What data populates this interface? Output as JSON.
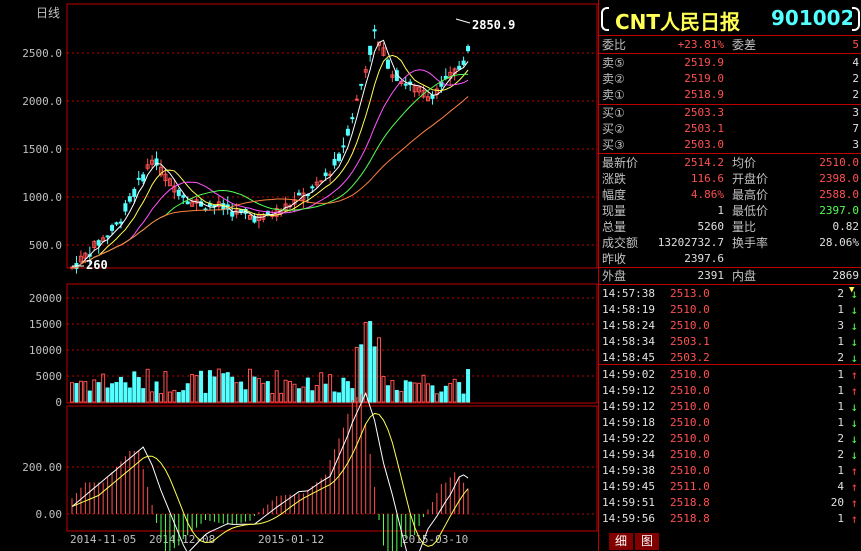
{
  "chart": {
    "period_label": "日线",
    "price_ticks": [
      "2500.0",
      "2000.0",
      "1500.0",
      "1000.0",
      "500.0"
    ],
    "vol_ticks": [
      "20000",
      "15000",
      "10000",
      "5000",
      "0"
    ],
    "macd_ticks": [
      "200.00",
      "0.00"
    ],
    "date_labels": [
      "2014-11-05",
      "2014-12-08",
      "2015-01-12",
      "2015-03-10"
    ],
    "high_annotation": "2850.9",
    "low_annotation": "260"
  },
  "quote": {
    "name": "CNT人民日报",
    "code": "901002",
    "weibi_label": "委比",
    "weibi_value": "+23.81%",
    "weicha_label": "委差",
    "weicha_value": "5",
    "sells": [
      {
        "label": "卖⑤",
        "price": "2519.9",
        "qty": "4"
      },
      {
        "label": "卖②",
        "price": "2519.0",
        "qty": "2"
      },
      {
        "label": "卖①",
        "price": "2518.9",
        "qty": "2"
      }
    ],
    "buys": [
      {
        "label": "买①",
        "price": "2503.3",
        "qty": "3"
      },
      {
        "label": "买②",
        "price": "2503.1",
        "qty": "7"
      },
      {
        "label": "买③",
        "price": "2503.0",
        "qty": "3"
      }
    ],
    "stats": [
      {
        "l1": "最新价",
        "v1": "2514.2",
        "c1": "red",
        "l2": "均价",
        "v2": "2510.0",
        "c2": "red"
      },
      {
        "l1": "涨跌",
        "v1": "116.6",
        "c1": "red",
        "l2": "开盘价",
        "v2": "2398.0",
        "c2": "red"
      },
      {
        "l1": "幅度",
        "v1": "4.86%",
        "c1": "red",
        "l2": "最高价",
        "v2": "2588.0",
        "c2": "red"
      },
      {
        "l1": "现量",
        "v1": "1",
        "c1": "white",
        "l2": "最低价",
        "v2": "2397.0",
        "c2": "green"
      },
      {
        "l1": "总量",
        "v1": "5260",
        "c1": "white",
        "l2": "量比",
        "v2": "0.82",
        "c2": "white"
      },
      {
        "l1": "成交额",
        "v1": "13202732.7",
        "c1": "white",
        "l2": "换手率",
        "v2": "28.06%",
        "c2": "white"
      }
    ],
    "zuoshou_label": "昨收",
    "zuoshou_value": "2397.6",
    "waipan_label": "外盘",
    "waipan_value": "2391",
    "neipan_label": "内盘",
    "neipan_value": "2869"
  },
  "ticks": [
    {
      "time": "14:57:38",
      "price": "2513.0",
      "vol": "2",
      "dir": "dn"
    },
    {
      "time": "14:58:19",
      "price": "2510.0",
      "vol": "1",
      "dir": "dn"
    },
    {
      "time": "14:58:24",
      "price": "2510.0",
      "vol": "3",
      "dir": "dn"
    },
    {
      "time": "14:58:34",
      "price": "2503.1",
      "vol": "1",
      "dir": "dn"
    },
    {
      "time": "14:58:45",
      "price": "2503.2",
      "vol": "2",
      "dir": "dn"
    },
    {
      "time": "14:59:02",
      "price": "2510.0",
      "vol": "1",
      "dir": "up"
    },
    {
      "time": "14:59:12",
      "price": "2510.0",
      "vol": "1",
      "dir": "up"
    },
    {
      "time": "14:59:12",
      "price": "2510.0",
      "vol": "1",
      "dir": "dn"
    },
    {
      "time": "14:59:18",
      "price": "2510.0",
      "vol": "1",
      "dir": "dn"
    },
    {
      "time": "14:59:22",
      "price": "2510.0",
      "vol": "2",
      "dir": "dn"
    },
    {
      "time": "14:59:34",
      "price": "2510.0",
      "vol": "2",
      "dir": "dn"
    },
    {
      "time": "14:59:38",
      "price": "2510.0",
      "vol": "1",
      "dir": "up"
    },
    {
      "time": "14:59:45",
      "price": "2511.0",
      "vol": "4",
      "dir": "up"
    },
    {
      "time": "14:59:51",
      "price": "2518.8",
      "vol": "20",
      "dir": "up"
    },
    {
      "time": "14:59:56",
      "price": "2518.8",
      "vol": "1",
      "dir": "up"
    }
  ],
  "tabs": [
    "细",
    "图"
  ],
  "colors": {
    "grid": "#c00000",
    "up": "#ff5050",
    "down": "#54ffff",
    "ma1": "#ffffff",
    "ma2": "#ffff54",
    "ma3": "#ff54ff",
    "ma4": "#54ff54",
    "ma5": "#ff8040"
  }
}
